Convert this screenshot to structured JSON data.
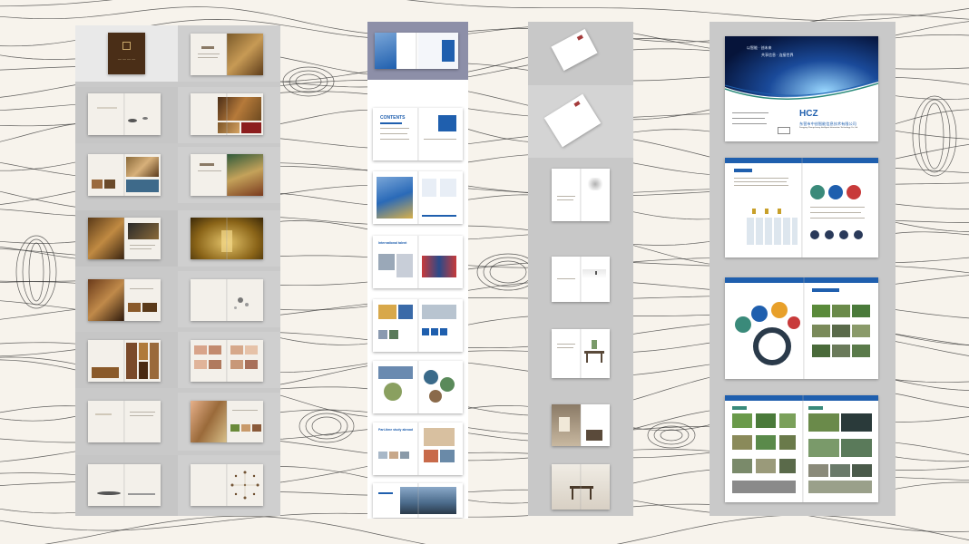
{
  "page": {
    "background": "#f7f3ec",
    "contour_color": "#2e2e2e"
  },
  "col1": {
    "name": "hotel-brochure-column",
    "accent": "#5b3a1e",
    "spreads": 15
  },
  "col2": {
    "name": "school-brochure-column",
    "accent": "#1f5fae",
    "texts": {
      "contents": "CONTENTS",
      "international": "International talent",
      "parttime": "Part-time study abroad"
    }
  },
  "col3": {
    "name": "minimal-interior-brochure-column",
    "accent": "#7a6a58"
  },
  "col4": {
    "name": "tech-company-brochure-column",
    "accent": "#1f5fae",
    "texts": {
      "company_cn": "东营市中创智能信息技术有限公司",
      "company_en": "Dongying Zhongchuang Intelligent Information Technology Co.,Ltd",
      "logo": "HCZ",
      "slogan_1": "以智能 · 创未来",
      "slogan_2": "共享信息 · 连接世界"
    }
  }
}
